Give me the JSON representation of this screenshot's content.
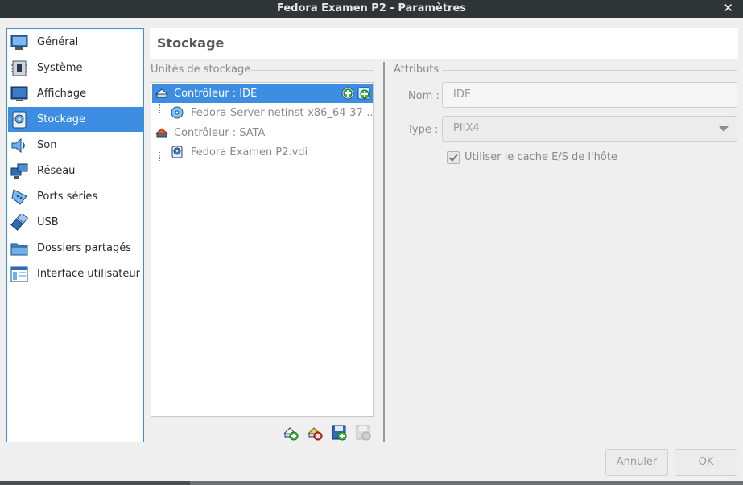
{
  "window": {
    "title": "Fedora Examen P2 - Paramètres",
    "close_glyph": "✕"
  },
  "sidebar": {
    "items": [
      {
        "label": "Général",
        "icon": "general-monitor-icon"
      },
      {
        "label": "Système",
        "icon": "chip-icon"
      },
      {
        "label": "Affichage",
        "icon": "display-icon"
      },
      {
        "label": "Stockage",
        "icon": "storage-disk-icon",
        "active": true
      },
      {
        "label": "Son",
        "icon": "speaker-icon"
      },
      {
        "label": "Réseau",
        "icon": "network-icon"
      },
      {
        "label": "Ports séries",
        "icon": "serial-port-icon"
      },
      {
        "label": "USB",
        "icon": "usb-icon"
      },
      {
        "label": "Dossiers partagés",
        "icon": "folder-icon"
      },
      {
        "label": "Interface utilisateur",
        "icon": "ui-window-icon"
      }
    ]
  },
  "panel": {
    "title": "Stockage"
  },
  "storage": {
    "group_title": "Unités de stockage",
    "tree": [
      {
        "label": "Contrôleur : IDE",
        "kind": "controller",
        "selected": true
      },
      {
        "label": "Fedora-Server-netinst-x86_64-37-...",
        "kind": "optical"
      },
      {
        "label": "Contrôleur : SATA",
        "kind": "controller"
      },
      {
        "label": "Fedora Examen P2.vdi",
        "kind": "harddisk"
      }
    ]
  },
  "attributes": {
    "group_title": "Attributs",
    "name_label": "Nom :",
    "name_value": "IDE",
    "type_label": "Type :",
    "type_value": "PIIX4",
    "cache_label": "Utiliser le cache E/S de l'hôte",
    "cache_checked": true
  },
  "buttons": {
    "cancel": "Annuler",
    "ok": "OK"
  },
  "colors": {
    "accent": "#3d8ee2",
    "titlebar": "#2f3437"
  }
}
